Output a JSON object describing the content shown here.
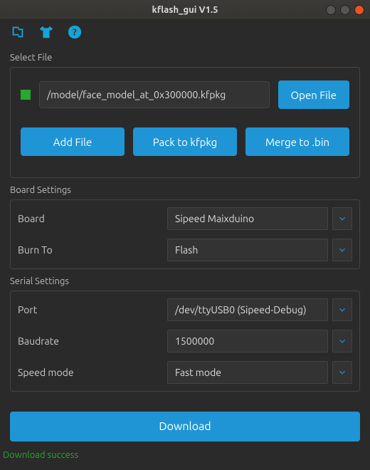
{
  "window": {
    "title": "kflash_gui V1.5"
  },
  "toolbar": {
    "icons": {
      "lang": "language-icon",
      "theme": "shirt-icon",
      "help": "help-icon"
    }
  },
  "select_file": {
    "label": "Select File",
    "file_path": "/model/face_model_at_0x300000.kfpkg",
    "color": "#27a92b",
    "open_button": "Open File",
    "add_button": "Add File",
    "pack_button": "Pack to kfpkg",
    "merge_button": "Merge to .bin"
  },
  "board_settings": {
    "label": "Board Settings",
    "rows": [
      {
        "label": "Board",
        "value": "Sipeed Maixduino"
      },
      {
        "label": "Burn To",
        "value": "Flash"
      }
    ]
  },
  "serial_settings": {
    "label": "Serial Settings",
    "rows": [
      {
        "label": "Port",
        "value": "/dev/ttyUSB0 (Sipeed-Debug)"
      },
      {
        "label": "Baudrate",
        "value": "1500000"
      },
      {
        "label": "Speed mode",
        "value": "Fast mode"
      }
    ]
  },
  "download_button": "Download",
  "status_text": "Download success"
}
